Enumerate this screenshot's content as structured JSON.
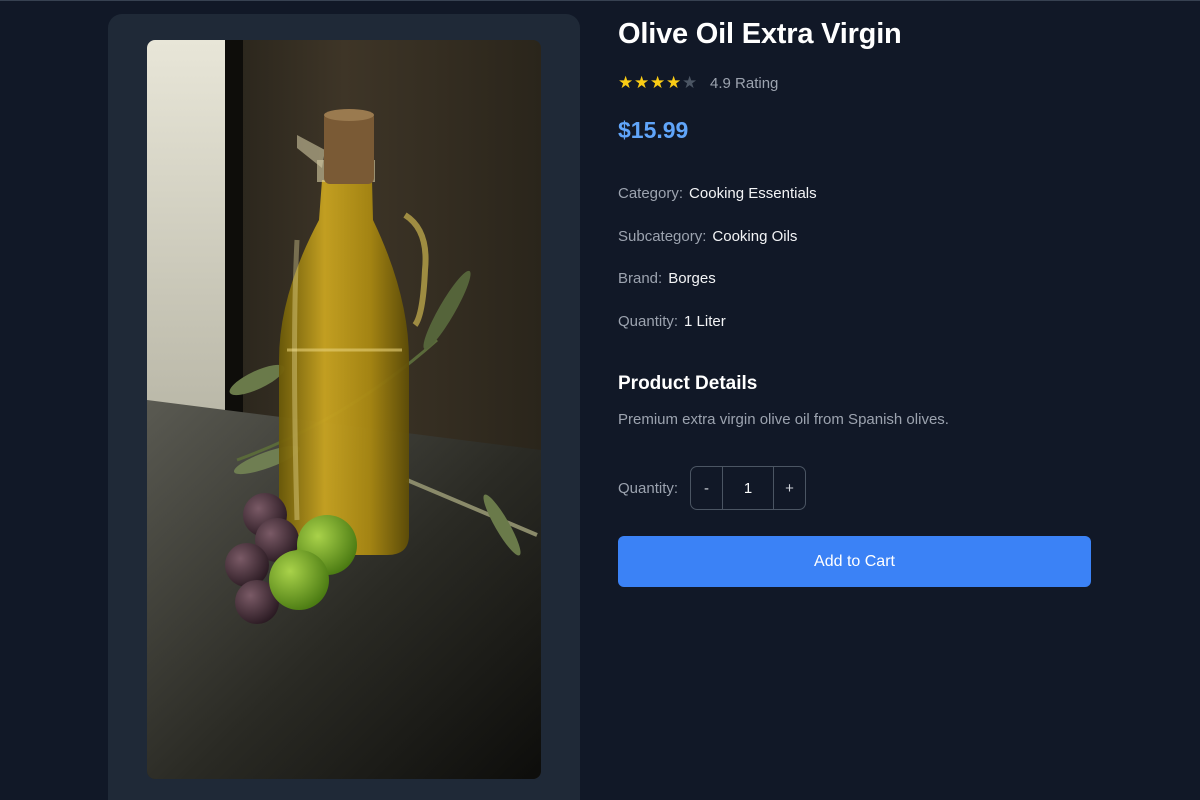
{
  "product": {
    "title": "Olive Oil Extra Virgin",
    "rating": {
      "stars_filled": 4,
      "stars_total": 5,
      "text": "4.9 Rating"
    },
    "price": "$15.99",
    "attributes": [
      {
        "label": "Category:",
        "value": "Cooking Essentials"
      },
      {
        "label": "Subcategory:",
        "value": "Cooking Oils"
      },
      {
        "label": "Brand:",
        "value": "Borges"
      },
      {
        "label": "Quantity:",
        "value": "1 Liter"
      }
    ],
    "details_heading": "Product Details",
    "description": "Premium extra virgin olive oil from Spanish olives."
  },
  "quantity": {
    "label": "Quantity:",
    "decrement": "-",
    "value": "1",
    "increment": "+"
  },
  "actions": {
    "add_to_cart": "Add to Cart"
  },
  "colors": {
    "background": "#111827",
    "card": "#1f2937",
    "accent": "#3b82f6",
    "price": "#60a5fa",
    "star": "#facc15"
  }
}
